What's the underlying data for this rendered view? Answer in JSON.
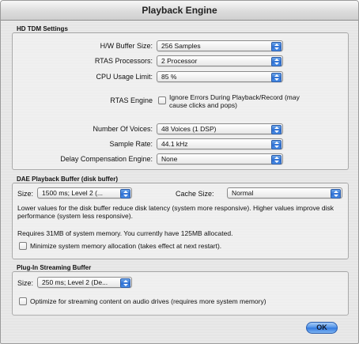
{
  "window": {
    "title": "Playback Engine"
  },
  "hd_tdm": {
    "title": "HD TDM Settings",
    "hw_buffer": {
      "label": "H/W Buffer Size:",
      "value": "256 Samples"
    },
    "rtas_processors": {
      "label": "RTAS Processors:",
      "value": "2 Processor"
    },
    "cpu_usage": {
      "label": "CPU Usage Limit:",
      "value": "85 %"
    },
    "rtas_engine": {
      "label": "RTAS Engine",
      "checkbox_label": "Ignore Errors During Playback/Record (may cause clicks and pops)"
    },
    "voices": {
      "label": "Number Of Voices:",
      "value": "48 Voices (1 DSP)"
    },
    "sample_rate": {
      "label": "Sample Rate:",
      "value": "44.1 kHz"
    },
    "delay_comp": {
      "label": "Delay Compensation Engine:",
      "value": "None"
    }
  },
  "dae": {
    "title": "DAE Playback Buffer (disk buffer)",
    "size": {
      "label": "Size:",
      "value": "1500 ms; Level 2 (..."
    },
    "cache": {
      "label": "Cache Size:",
      "value": "Normal"
    },
    "description": "Lower values for the disk buffer reduce disk latency (system more responsive).  Higher values improve disk performance (system less responsive).",
    "memory_info": "Requires 31MB of system memory. You currently have 125MB allocated.",
    "minimize_label": "Minimize system memory allocation (takes effect at next restart)."
  },
  "plugin": {
    "title": "Plug-In Streaming Buffer",
    "size": {
      "label": "Size:",
      "value": "250 ms; Level 2 (De..."
    },
    "optimize_label": "Optimize for streaming content on audio drives (requires more system memory)"
  },
  "ok_label": "OK"
}
